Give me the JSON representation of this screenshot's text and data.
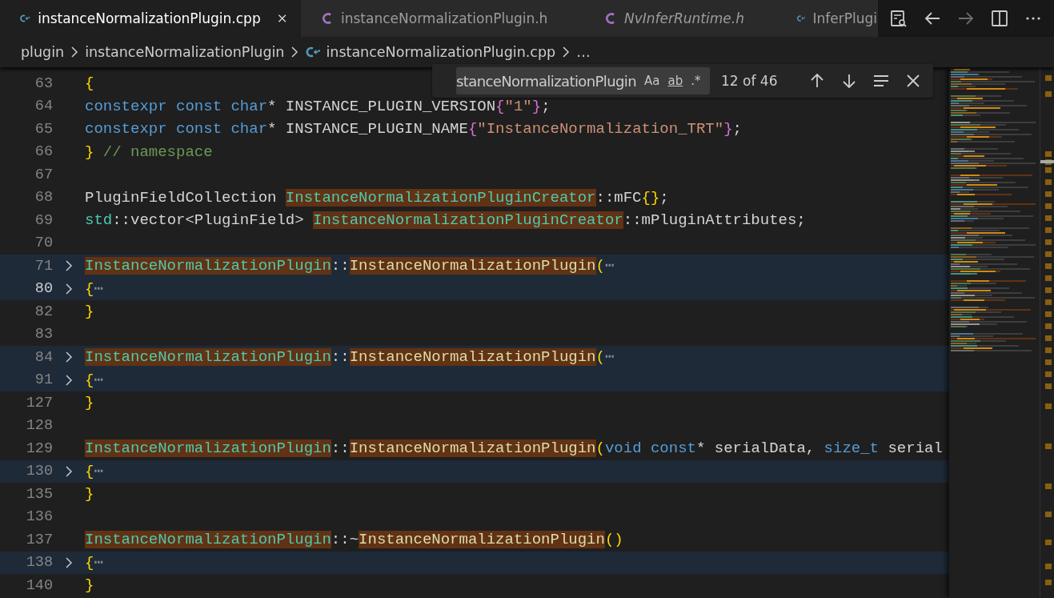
{
  "tabs": [
    {
      "kind": "cpp",
      "label": "instanceNormalizationPlugin.cpp",
      "selected": true,
      "preview": false
    },
    {
      "kind": "c",
      "label": "instanceNormalizationPlugin.h",
      "selected": false,
      "preview": false
    },
    {
      "kind": "c",
      "label": "NvInferRuntime.h",
      "selected": false,
      "preview": true
    },
    {
      "kind": "cpp",
      "label": "InferPlugi",
      "selected": false,
      "preview": false
    }
  ],
  "toolbar": [
    {
      "kind": "changes",
      "disabled": false
    },
    {
      "kind": "back",
      "disabled": false
    },
    {
      "kind": "forward",
      "disabled": true
    },
    {
      "kind": "split",
      "disabled": false
    },
    {
      "kind": "more",
      "disabled": false
    }
  ],
  "breadcrumbs": [
    {
      "label": "plugin",
      "kind": "folder"
    },
    {
      "label": "instanceNormalizationPlugin",
      "kind": "folder"
    },
    {
      "label": "instanceNormalizationPlugin.cpp",
      "kind": "cpp"
    },
    {
      "label": "…",
      "kind": "symbol"
    }
  ],
  "find": {
    "value": "stanceNormalizationPlugin",
    "options": [
      {
        "label": "Aa",
        "on": false
      },
      {
        "label": "ab",
        "on": false
      },
      {
        "label": ".*",
        "on": false
      }
    ],
    "count": "12 of 46"
  },
  "code_lines": [
    {
      "number": "63",
      "folded": false,
      "current": false,
      "tokens": [
        {
          "text": "{",
          "kind": "bracket1",
          "highlighted": false
        }
      ]
    },
    {
      "number": "64",
      "folded": false,
      "current": false,
      "tokens": [
        {
          "text": "constexpr const char",
          "kind": "keyword",
          "highlighted": false
        },
        {
          "text": "* INSTANCE_PLUGIN_VERSION",
          "kind": "plain",
          "highlighted": false
        },
        {
          "text": "{",
          "kind": "bracket2",
          "highlighted": false
        },
        {
          "text": "\"1\"",
          "kind": "string",
          "highlighted": false
        },
        {
          "text": "}",
          "kind": "bracket2",
          "highlighted": false
        },
        {
          "text": ";",
          "kind": "plain",
          "highlighted": false
        }
      ]
    },
    {
      "number": "65",
      "folded": false,
      "current": false,
      "tokens": [
        {
          "text": "constexpr const char",
          "kind": "keyword",
          "highlighted": false
        },
        {
          "text": "* INSTANCE_PLUGIN_NAME",
          "kind": "plain",
          "highlighted": false
        },
        {
          "text": "{",
          "kind": "bracket2",
          "highlighted": false
        },
        {
          "text": "\"InstanceNormalization_TRT\"",
          "kind": "string",
          "highlighted": false
        },
        {
          "text": "}",
          "kind": "bracket2",
          "highlighted": false
        },
        {
          "text": ";",
          "kind": "plain",
          "highlighted": false
        }
      ]
    },
    {
      "number": "66",
      "folded": false,
      "current": false,
      "tokens": [
        {
          "text": "}",
          "kind": "bracket1",
          "highlighted": false
        },
        {
          "text": " // namespace",
          "kind": "comment",
          "highlighted": false
        }
      ]
    },
    {
      "number": "67",
      "folded": false,
      "current": false
    },
    {
      "number": "68",
      "folded": false,
      "current": false,
      "tokens": [
        {
          "text": "PluginFieldCollection ",
          "kind": "plain",
          "highlighted": false
        },
        {
          "text": "InstanceNormalizationPluginCreator",
          "kind": "type",
          "highlighted": true
        },
        {
          "text": "::mFC",
          "kind": "plain",
          "highlighted": false
        },
        {
          "text": "{}",
          "kind": "bracket1",
          "highlighted": false
        },
        {
          "text": ";",
          "kind": "plain",
          "highlighted": false
        }
      ]
    },
    {
      "number": "69",
      "folded": false,
      "current": false,
      "tokens": [
        {
          "text": "std",
          "kind": "type",
          "highlighted": false
        },
        {
          "text": "::vector<PluginField> ",
          "kind": "plain",
          "highlighted": false
        },
        {
          "text": "InstanceNormalizationPluginCreator",
          "kind": "type",
          "highlighted": true
        },
        {
          "text": "::mPluginAttributes;",
          "kind": "plain",
          "highlighted": false
        }
      ]
    },
    {
      "number": "70",
      "folded": false,
      "current": false
    },
    {
      "number": "71",
      "folded": true,
      "current": false,
      "tokens": [
        {
          "text": "InstanceNormalizationPlugin",
          "kind": "type",
          "highlighted": true
        },
        {
          "text": "::",
          "kind": "plain",
          "highlighted": false
        },
        {
          "text": "InstanceNormalizationPlugin",
          "kind": "function",
          "highlighted": true
        },
        {
          "text": "(",
          "kind": "bracket1",
          "highlighted": false
        },
        {
          "text": "⋯",
          "kind": "ellipsis",
          "highlighted": false
        }
      ]
    },
    {
      "number": "80",
      "folded": true,
      "current": true,
      "tokens": [
        {
          "text": "{",
          "kind": "bracket1",
          "highlighted": false
        },
        {
          "text": "⋯",
          "kind": "ellipsis",
          "highlighted": false
        }
      ]
    },
    {
      "number": "82",
      "folded": false,
      "current": false,
      "tokens": [
        {
          "text": "}",
          "kind": "bracket1",
          "highlighted": false
        }
      ]
    },
    {
      "number": "83",
      "folded": false,
      "current": false
    },
    {
      "number": "84",
      "folded": true,
      "current": false,
      "tokens": [
        {
          "text": "InstanceNormalizationPlugin",
          "kind": "type",
          "highlighted": true
        },
        {
          "text": "::",
          "kind": "plain",
          "highlighted": false
        },
        {
          "text": "InstanceNormalizationPlugin",
          "kind": "function",
          "highlighted": true
        },
        {
          "text": "(",
          "kind": "bracket1",
          "highlighted": false
        },
        {
          "text": "⋯",
          "kind": "ellipsis",
          "highlighted": false
        }
      ]
    },
    {
      "number": "91",
      "folded": true,
      "current": false,
      "tokens": [
        {
          "text": "{",
          "kind": "bracket1",
          "highlighted": false
        },
        {
          "text": "⋯",
          "kind": "ellipsis",
          "highlighted": false
        }
      ]
    },
    {
      "number": "127",
      "folded": false,
      "current": false,
      "tokens": [
        {
          "text": "}",
          "kind": "bracket1",
          "highlighted": false
        }
      ]
    },
    {
      "number": "128",
      "folded": false,
      "current": false
    },
    {
      "number": "129",
      "folded": false,
      "current": false,
      "tokens": [
        {
          "text": "InstanceNormalizationPlugin",
          "kind": "type",
          "highlighted": true
        },
        {
          "text": "::",
          "kind": "plain",
          "highlighted": false
        },
        {
          "text": "InstanceNormalizationPlugin",
          "kind": "function",
          "highlighted": true
        },
        {
          "text": "(",
          "kind": "bracket1",
          "highlighted": false
        },
        {
          "text": "void const",
          "kind": "keyword",
          "highlighted": false
        },
        {
          "text": "* serialData, ",
          "kind": "plain",
          "highlighted": false
        },
        {
          "text": "size_t",
          "kind": "keyword",
          "highlighted": false
        },
        {
          "text": " serial",
          "kind": "plain",
          "highlighted": false
        }
      ]
    },
    {
      "number": "130",
      "folded": true,
      "current": false,
      "tokens": [
        {
          "text": "{",
          "kind": "bracket1",
          "highlighted": false
        },
        {
          "text": "⋯",
          "kind": "ellipsis",
          "highlighted": false
        }
      ]
    },
    {
      "number": "135",
      "folded": false,
      "current": false,
      "tokens": [
        {
          "text": "}",
          "kind": "bracket1",
          "highlighted": false
        }
      ]
    },
    {
      "number": "136",
      "folded": false,
      "current": false
    },
    {
      "number": "137",
      "folded": false,
      "current": false,
      "tokens": [
        {
          "text": "InstanceNormalizationPlugin",
          "kind": "type",
          "highlighted": true
        },
        {
          "text": "::~",
          "kind": "plain",
          "highlighted": false
        },
        {
          "text": "InstanceNormalizationPlugin",
          "kind": "function",
          "highlighted": true
        },
        {
          "text": "()",
          "kind": "bracket1",
          "highlighted": false
        }
      ]
    },
    {
      "number": "138",
      "folded": true,
      "current": false,
      "tokens": [
        {
          "text": "{",
          "kind": "bracket1",
          "highlighted": false
        },
        {
          "text": "⋯",
          "kind": "ellipsis",
          "highlighted": false
        }
      ]
    },
    {
      "number": "140",
      "folded": false,
      "current": false,
      "tokens": [
        {
          "text": "}",
          "kind": "bracket1",
          "highlighted": false
        }
      ]
    }
  ]
}
